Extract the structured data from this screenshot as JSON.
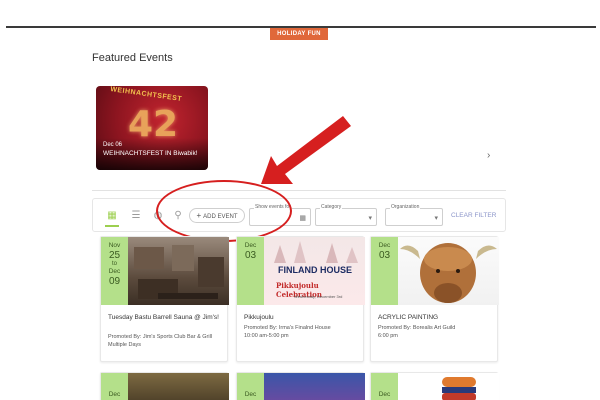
{
  "header": {
    "badge": "HOLIDAY FUN"
  },
  "featured": {
    "title": "Featured Events",
    "card": {
      "banner": "WEIHNACHTSFEST",
      "number": "42",
      "date": "Dec 06",
      "title": "WEIHNACHTSFEST IN Biwabik!"
    }
  },
  "toolbar": {
    "add_event": "ADD EVENT",
    "show_events_label": "Show events for",
    "category_label": "Category",
    "organization_label": "Organization",
    "clear_filter": "CLEAR FILTER"
  },
  "events": [
    {
      "month": "Nov",
      "day": "25",
      "to": "to",
      "end_month": "Dec",
      "end_day": "09",
      "title": "Tuesday Bastu Barrell Sauna @ Jim's!",
      "promoter": "Promoted By: Jim's Sports Club Bar & Grill",
      "time": "Multiple Days"
    },
    {
      "month": "Dec",
      "day": "03",
      "title": "Pikkujoulu",
      "promoter": "Promoted By: Irma's Finalnd House",
      "time": "10:00 am-5:00 pm",
      "image_text": {
        "brand": "FINLAND HOUSE",
        "headline": "Pikkujoulu Celebration",
        "sub": "Wednesday, December 3rd"
      }
    },
    {
      "month": "Dec",
      "day": "03",
      "title": "ACRYLIC PAINTING",
      "promoter": "Promoted By: Borealis Art Guild",
      "time": "6:00 pm"
    }
  ],
  "bottom_row": [
    {
      "month": "Dec"
    },
    {
      "month": "Dec"
    },
    {
      "month": "Dec"
    }
  ],
  "colors": {
    "accent_green": "#b4e08a",
    "badge_orange": "#e0683a",
    "annotation_red": "#d61f1f"
  }
}
